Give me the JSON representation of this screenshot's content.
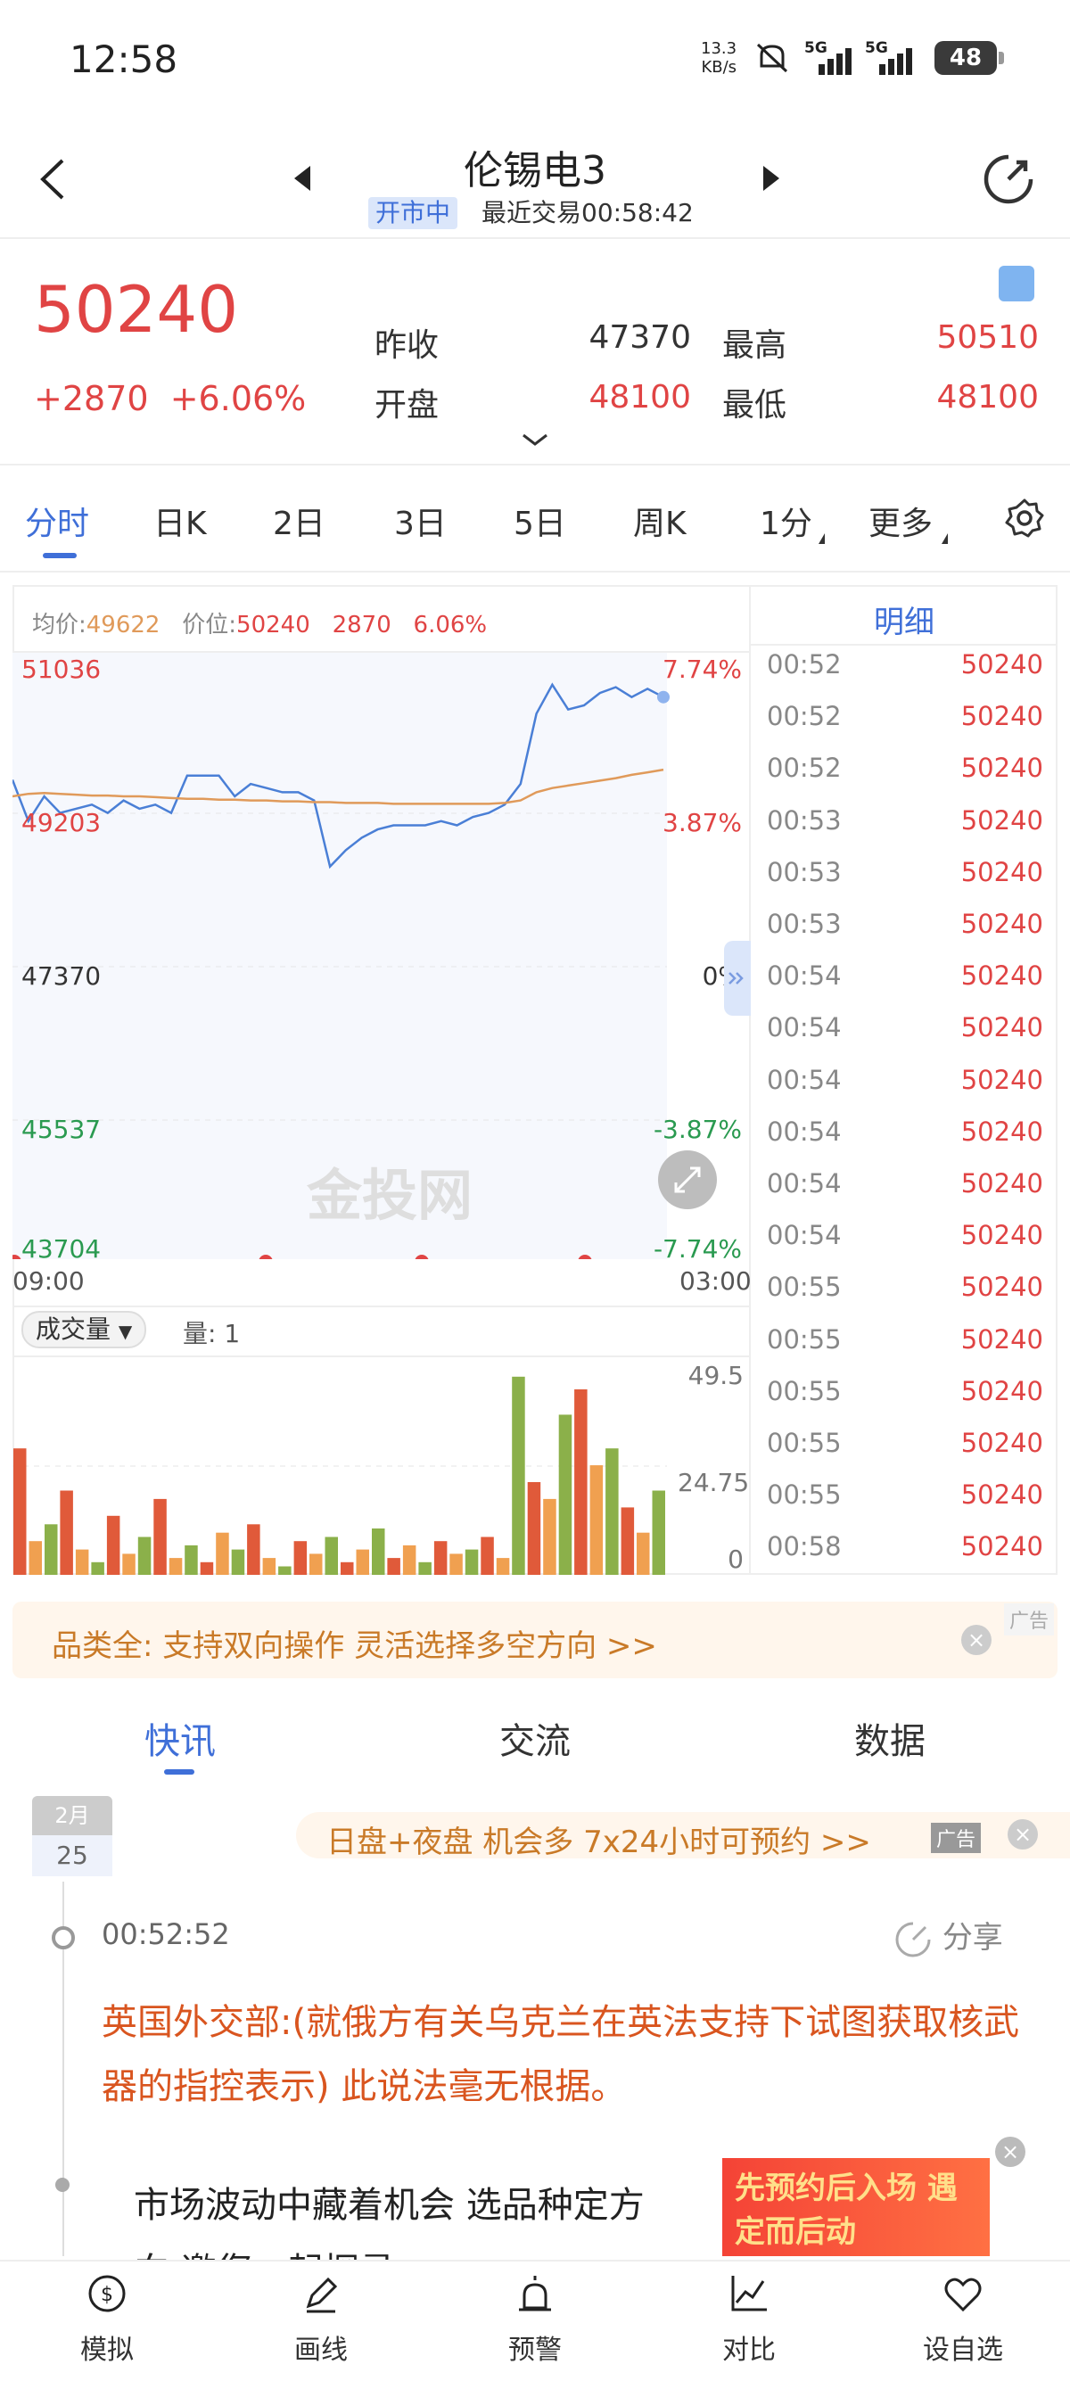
{
  "status_bar": {
    "time": "12:58",
    "net_speed_value": "13.3",
    "net_speed_unit": "KB/s",
    "signal_1": "5G",
    "signal_2": "5G",
    "battery": "48"
  },
  "header": {
    "title": "伦锡电3",
    "market_status": "开市中",
    "last_trade": "最近交易00:58:42"
  },
  "quote": {
    "price": "50240",
    "change_abs": "+2870",
    "change_pct": "+6.06%",
    "prev_close_label": "昨收",
    "prev_close": "47370",
    "open_label": "开盘",
    "open": "48100",
    "high_label": "最高",
    "high": "50510",
    "low_label": "最低",
    "low": "48100"
  },
  "chart_tabs": [
    "分时",
    "日K",
    "2日",
    "3日",
    "5日",
    "周K",
    "1分",
    "更多"
  ],
  "chart": {
    "avg_label": "均价:",
    "avg_value": "49622",
    "price_label": "价位:",
    "price_value": "50240",
    "change_value": "2870",
    "change_pct": "6.06%",
    "left_axis": [
      "51036",
      "49203",
      "47370",
      "45537",
      "43704"
    ],
    "right_axis": [
      "7.74%",
      "3.87%",
      "0%",
      "-3.87%",
      "-7.74%"
    ],
    "x_start": "09:00",
    "x_end": "03:00",
    "watermark": "金投网",
    "volume_dropdown": "成交量",
    "volume_count": "量: 1",
    "volume_axis": [
      "49.5",
      "24.75",
      "0"
    ]
  },
  "chart_data": [
    {
      "type": "line",
      "title": "",
      "x_range": [
        "09:00",
        "03:00"
      ],
      "ylim": [
        43704,
        51036
      ],
      "series": [
        {
          "name": "价位",
          "color": "#4a7fd6",
          "values": [
            49500,
            49000,
            49300,
            49100,
            49150,
            49200,
            49100,
            49250,
            49150,
            49200,
            49100,
            49550,
            49550,
            49550,
            49300,
            49450,
            49400,
            49350,
            49350,
            49250,
            48450,
            48650,
            48800,
            48900,
            48950,
            48950,
            48950,
            49000,
            48950,
            49050,
            49100,
            49200,
            49450,
            50300,
            50650,
            50350,
            50400,
            50550,
            50620,
            50500,
            50600,
            50500
          ]
        },
        {
          "name": "均价",
          "color": "#e09a5a",
          "values": [
            49300,
            49330,
            49340,
            49330,
            49320,
            49310,
            49310,
            49300,
            49300,
            49290,
            49280,
            49270,
            49270,
            49260,
            49260,
            49250,
            49250,
            49240,
            49240,
            49230,
            49230,
            49220,
            49220,
            49220,
            49210,
            49210,
            49210,
            49210,
            49210,
            49210,
            49210,
            49220,
            49250,
            49350,
            49400,
            49430,
            49460,
            49490,
            49520,
            49560,
            49590,
            49622
          ]
        }
      ]
    },
    {
      "type": "bar",
      "title": "成交量",
      "ylim": [
        0,
        49.5
      ],
      "values": [
        30,
        8,
        12,
        20,
        6,
        3,
        14,
        5,
        9,
        18,
        4,
        7,
        3,
        10,
        6,
        12,
        4,
        2,
        8,
        5,
        9,
        3,
        6,
        11,
        4,
        7,
        3,
        8,
        5,
        6,
        9,
        4,
        47,
        22,
        18,
        38,
        44,
        26,
        30,
        16,
        10,
        20
      ]
    }
  ],
  "detail": {
    "title": "明细",
    "rows": [
      {
        "time": "00:52",
        "price": "50240"
      },
      {
        "time": "00:52",
        "price": "50240"
      },
      {
        "time": "00:52",
        "price": "50240"
      },
      {
        "time": "00:53",
        "price": "50240"
      },
      {
        "time": "00:53",
        "price": "50240"
      },
      {
        "time": "00:53",
        "price": "50240"
      },
      {
        "time": "00:54",
        "price": "50240"
      },
      {
        "time": "00:54",
        "price": "50240"
      },
      {
        "time": "00:54",
        "price": "50240"
      },
      {
        "time": "00:54",
        "price": "50240"
      },
      {
        "time": "00:54",
        "price": "50240"
      },
      {
        "time": "00:54",
        "price": "50240"
      },
      {
        "time": "00:55",
        "price": "50240"
      },
      {
        "time": "00:55",
        "price": "50240"
      },
      {
        "time": "00:55",
        "price": "50240"
      },
      {
        "time": "00:55",
        "price": "50240"
      },
      {
        "time": "00:55",
        "price": "50240"
      },
      {
        "time": "00:58",
        "price": "50240"
      }
    ]
  },
  "ad_banner": {
    "text": "品类全: 支持双向操作 灵活选择多空方向 >>",
    "tag": "广告"
  },
  "news_tabs": [
    "快讯",
    "交流",
    "数据"
  ],
  "news": {
    "date_month": "2月",
    "date_day": "25",
    "promo": "日盘+夜盘 机会多 7x24小时可预约 >>",
    "promo_tag": "广告",
    "time": "00:52:52",
    "share": "分享",
    "text": "英国外交部:(就俄方有关乌克兰在英法支持下试图获取核武器的指控表示) 此说法毫无根据。",
    "ad2_text": "市场波动中藏着机会 选品种定方向 邀您一起探寻 >>",
    "ad2_image_text": "先预约后入场 遇定而后动"
  },
  "bottom_nav": [
    "模拟",
    "画线",
    "预警",
    "对比",
    "设自选"
  ],
  "colors": {
    "accent": "#3f6fd8",
    "up": "#e04444",
    "down": "#2a9a50",
    "avg_line": "#e09a5a",
    "price_line": "#4a7fd6"
  }
}
